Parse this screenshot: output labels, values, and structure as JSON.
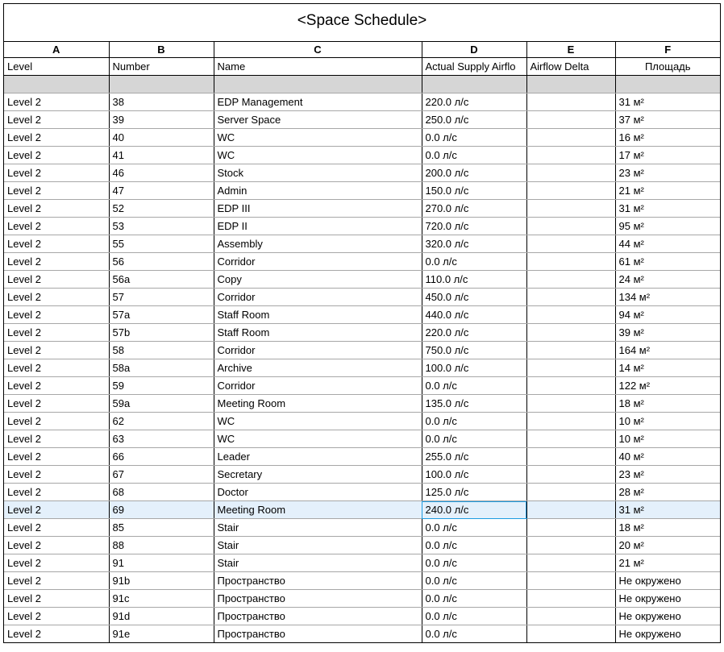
{
  "title": "<Space Schedule>",
  "columns": [
    "A",
    "B",
    "C",
    "D",
    "E",
    "F"
  ],
  "fields": {
    "A": "Level",
    "B": "Number",
    "C": "Name",
    "D": "Actual Supply Airflo",
    "E": "Airflow Delta",
    "F": "Площадь"
  },
  "selected_row_index": 24,
  "selected_col_index": 3,
  "rows": [
    {
      "A": "Level 2",
      "B": "38",
      "C": "EDP Management",
      "D": "220.0 л/с",
      "E": "",
      "F": "31 м²"
    },
    {
      "A": "Level 2",
      "B": "39",
      "C": "Server Space",
      "D": "250.0 л/с",
      "E": "",
      "F": "37 м²"
    },
    {
      "A": "Level 2",
      "B": "40",
      "C": "WC",
      "D": "0.0 л/с",
      "E": "",
      "F": "16 м²"
    },
    {
      "A": "Level 2",
      "B": "41",
      "C": "WC",
      "D": "0.0 л/с",
      "E": "",
      "F": "17 м²"
    },
    {
      "A": "Level 2",
      "B": "46",
      "C": "Stock",
      "D": "200.0 л/с",
      "E": "",
      "F": "23 м²"
    },
    {
      "A": "Level 2",
      "B": "47",
      "C": "Admin",
      "D": "150.0 л/с",
      "E": "",
      "F": "21 м²"
    },
    {
      "A": "Level 2",
      "B": "52",
      "C": "EDP III",
      "D": "270.0 л/с",
      "E": "",
      "F": "31 м²"
    },
    {
      "A": "Level 2",
      "B": "53",
      "C": "EDP II",
      "D": "720.0 л/с",
      "E": "",
      "F": "95 м²"
    },
    {
      "A": "Level 2",
      "B": "55",
      "C": "Assembly",
      "D": "320.0 л/с",
      "E": "",
      "F": "44 м²"
    },
    {
      "A": "Level 2",
      "B": "56",
      "C": "Corridor",
      "D": "0.0 л/с",
      "E": "",
      "F": "61 м²"
    },
    {
      "A": "Level 2",
      "B": "56a",
      "C": "Copy",
      "D": "110.0 л/с",
      "E": "",
      "F": "24 м²"
    },
    {
      "A": "Level 2",
      "B": "57",
      "C": "Corridor",
      "D": "450.0 л/с",
      "E": "",
      "F": "134 м²"
    },
    {
      "A": "Level 2",
      "B": "57a",
      "C": "Staff Room",
      "D": "440.0 л/с",
      "E": "",
      "F": "94 м²"
    },
    {
      "A": "Level 2",
      "B": "57b",
      "C": "Staff Room",
      "D": "220.0 л/с",
      "E": "",
      "F": "39 м²"
    },
    {
      "A": "Level 2",
      "B": "58",
      "C": "Corridor",
      "D": "750.0 л/с",
      "E": "",
      "F": "164 м²"
    },
    {
      "A": "Level 2",
      "B": "58a",
      "C": "Archive",
      "D": "100.0 л/с",
      "E": "",
      "F": "14 м²"
    },
    {
      "A": "Level 2",
      "B": "59",
      "C": "Corridor",
      "D": "0.0 л/с",
      "E": "",
      "F": "122 м²"
    },
    {
      "A": "Level 2",
      "B": "59a",
      "C": "Meeting Room",
      "D": "135.0 л/с",
      "E": "",
      "F": "18 м²"
    },
    {
      "A": "Level 2",
      "B": "62",
      "C": "WC",
      "D": "0.0 л/с",
      "E": "",
      "F": "10 м²"
    },
    {
      "A": "Level 2",
      "B": "63",
      "C": "WC",
      "D": "0.0 л/с",
      "E": "",
      "F": "10 м²"
    },
    {
      "A": "Level 2",
      "B": "66",
      "C": "Leader",
      "D": "255.0 л/с",
      "E": "",
      "F": "40 м²"
    },
    {
      "A": "Level 2",
      "B": "67",
      "C": "Secretary",
      "D": "100.0 л/с",
      "E": "",
      "F": "23 м²"
    },
    {
      "A": "Level 2",
      "B": "68",
      "C": "Doctor",
      "D": "125.0 л/с",
      "E": "",
      "F": "28 м²"
    },
    {
      "A": "Level 2",
      "B": "69",
      "C": "Meeting Room",
      "D": "240.0 л/с",
      "E": "",
      "F": "31 м²"
    },
    {
      "A": "Level 2",
      "B": "85",
      "C": "Stair",
      "D": "0.0 л/с",
      "E": "",
      "F": "18 м²"
    },
    {
      "A": "Level 2",
      "B": "88",
      "C": "Stair",
      "D": "0.0 л/с",
      "E": "",
      "F": "20 м²"
    },
    {
      "A": "Level 2",
      "B": "91",
      "C": "Stair",
      "D": "0.0 л/с",
      "E": "",
      "F": "21 м²"
    },
    {
      "A": "Level 2",
      "B": "91b",
      "C": "Пространство",
      "D": "0.0 л/с",
      "E": "",
      "F": "Не окружено"
    },
    {
      "A": "Level 2",
      "B": "91c",
      "C": "Пространство",
      "D": "0.0 л/с",
      "E": "",
      "F": "Не окружено"
    },
    {
      "A": "Level 2",
      "B": "91d",
      "C": "Пространство",
      "D": "0.0 л/с",
      "E": "",
      "F": "Не окружено"
    },
    {
      "A": "Level 2",
      "B": "91e",
      "C": "Пространство",
      "D": "0.0 л/с",
      "E": "",
      "F": "Не окружено"
    }
  ]
}
